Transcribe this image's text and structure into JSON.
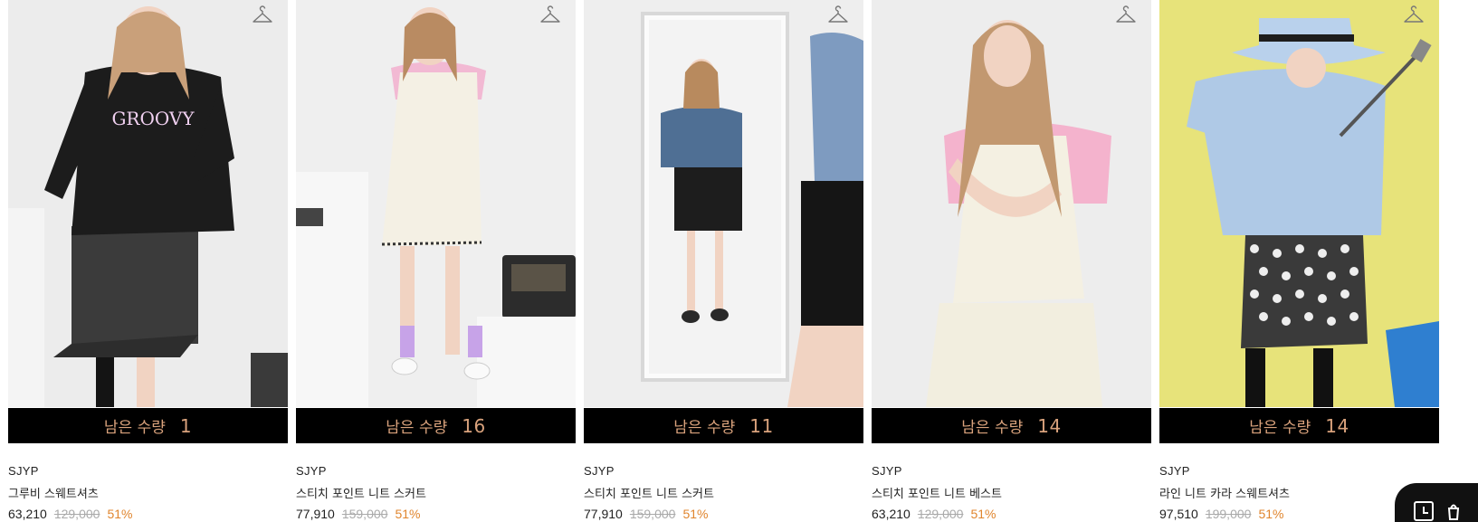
{
  "products": [
    {
      "brand": "SJYP",
      "name": "그루비 스웨트셔츠",
      "stock_label": "남은 수량",
      "stock": "1",
      "sale_price": "63,210",
      "original_price": "129,000",
      "discount": "51%",
      "image_desc": "woman-black-sweatshirt-denim-skirt"
    },
    {
      "brand": "SJYP",
      "name": "스티치 포인트 니트 스커트",
      "stock_label": "남은 수량",
      "stock": "16",
      "sale_price": "77,910",
      "original_price": "159,000",
      "discount": "51%",
      "image_desc": "woman-white-knit-dress-pink-tee"
    },
    {
      "brand": "SJYP",
      "name": "스티치 포인트 니트 스커트",
      "stock_label": "남은 수량",
      "stock": "11",
      "sale_price": "77,910",
      "original_price": "159,000",
      "discount": "51%",
      "image_desc": "woman-denim-jacket-mirror"
    },
    {
      "brand": "SJYP",
      "name": "스티치 포인트 니트 베스트",
      "stock_label": "남은 수량",
      "stock": "14",
      "sale_price": "63,210",
      "original_price": "129,000",
      "discount": "51%",
      "image_desc": "woman-pink-tee-white-knit-vest"
    },
    {
      "brand": "SJYP",
      "name": "라인 니트 카라 스웨트셔츠",
      "stock_label": "남은 수량",
      "stock": "14",
      "sale_price": "97,510",
      "original_price": "199,000",
      "discount": "51%",
      "image_desc": "woman-blue-sweatshirt-bucket-hat-golf"
    }
  ],
  "icons": {
    "wishlist": "hanger-icon",
    "recent": "clock-icon",
    "cart": "cart-icon"
  },
  "colors": {
    "stock_bar_bg": "#000000",
    "stock_text": "#d9a27c",
    "discount": "#e0852d",
    "original_price": "#aaaaaa"
  }
}
